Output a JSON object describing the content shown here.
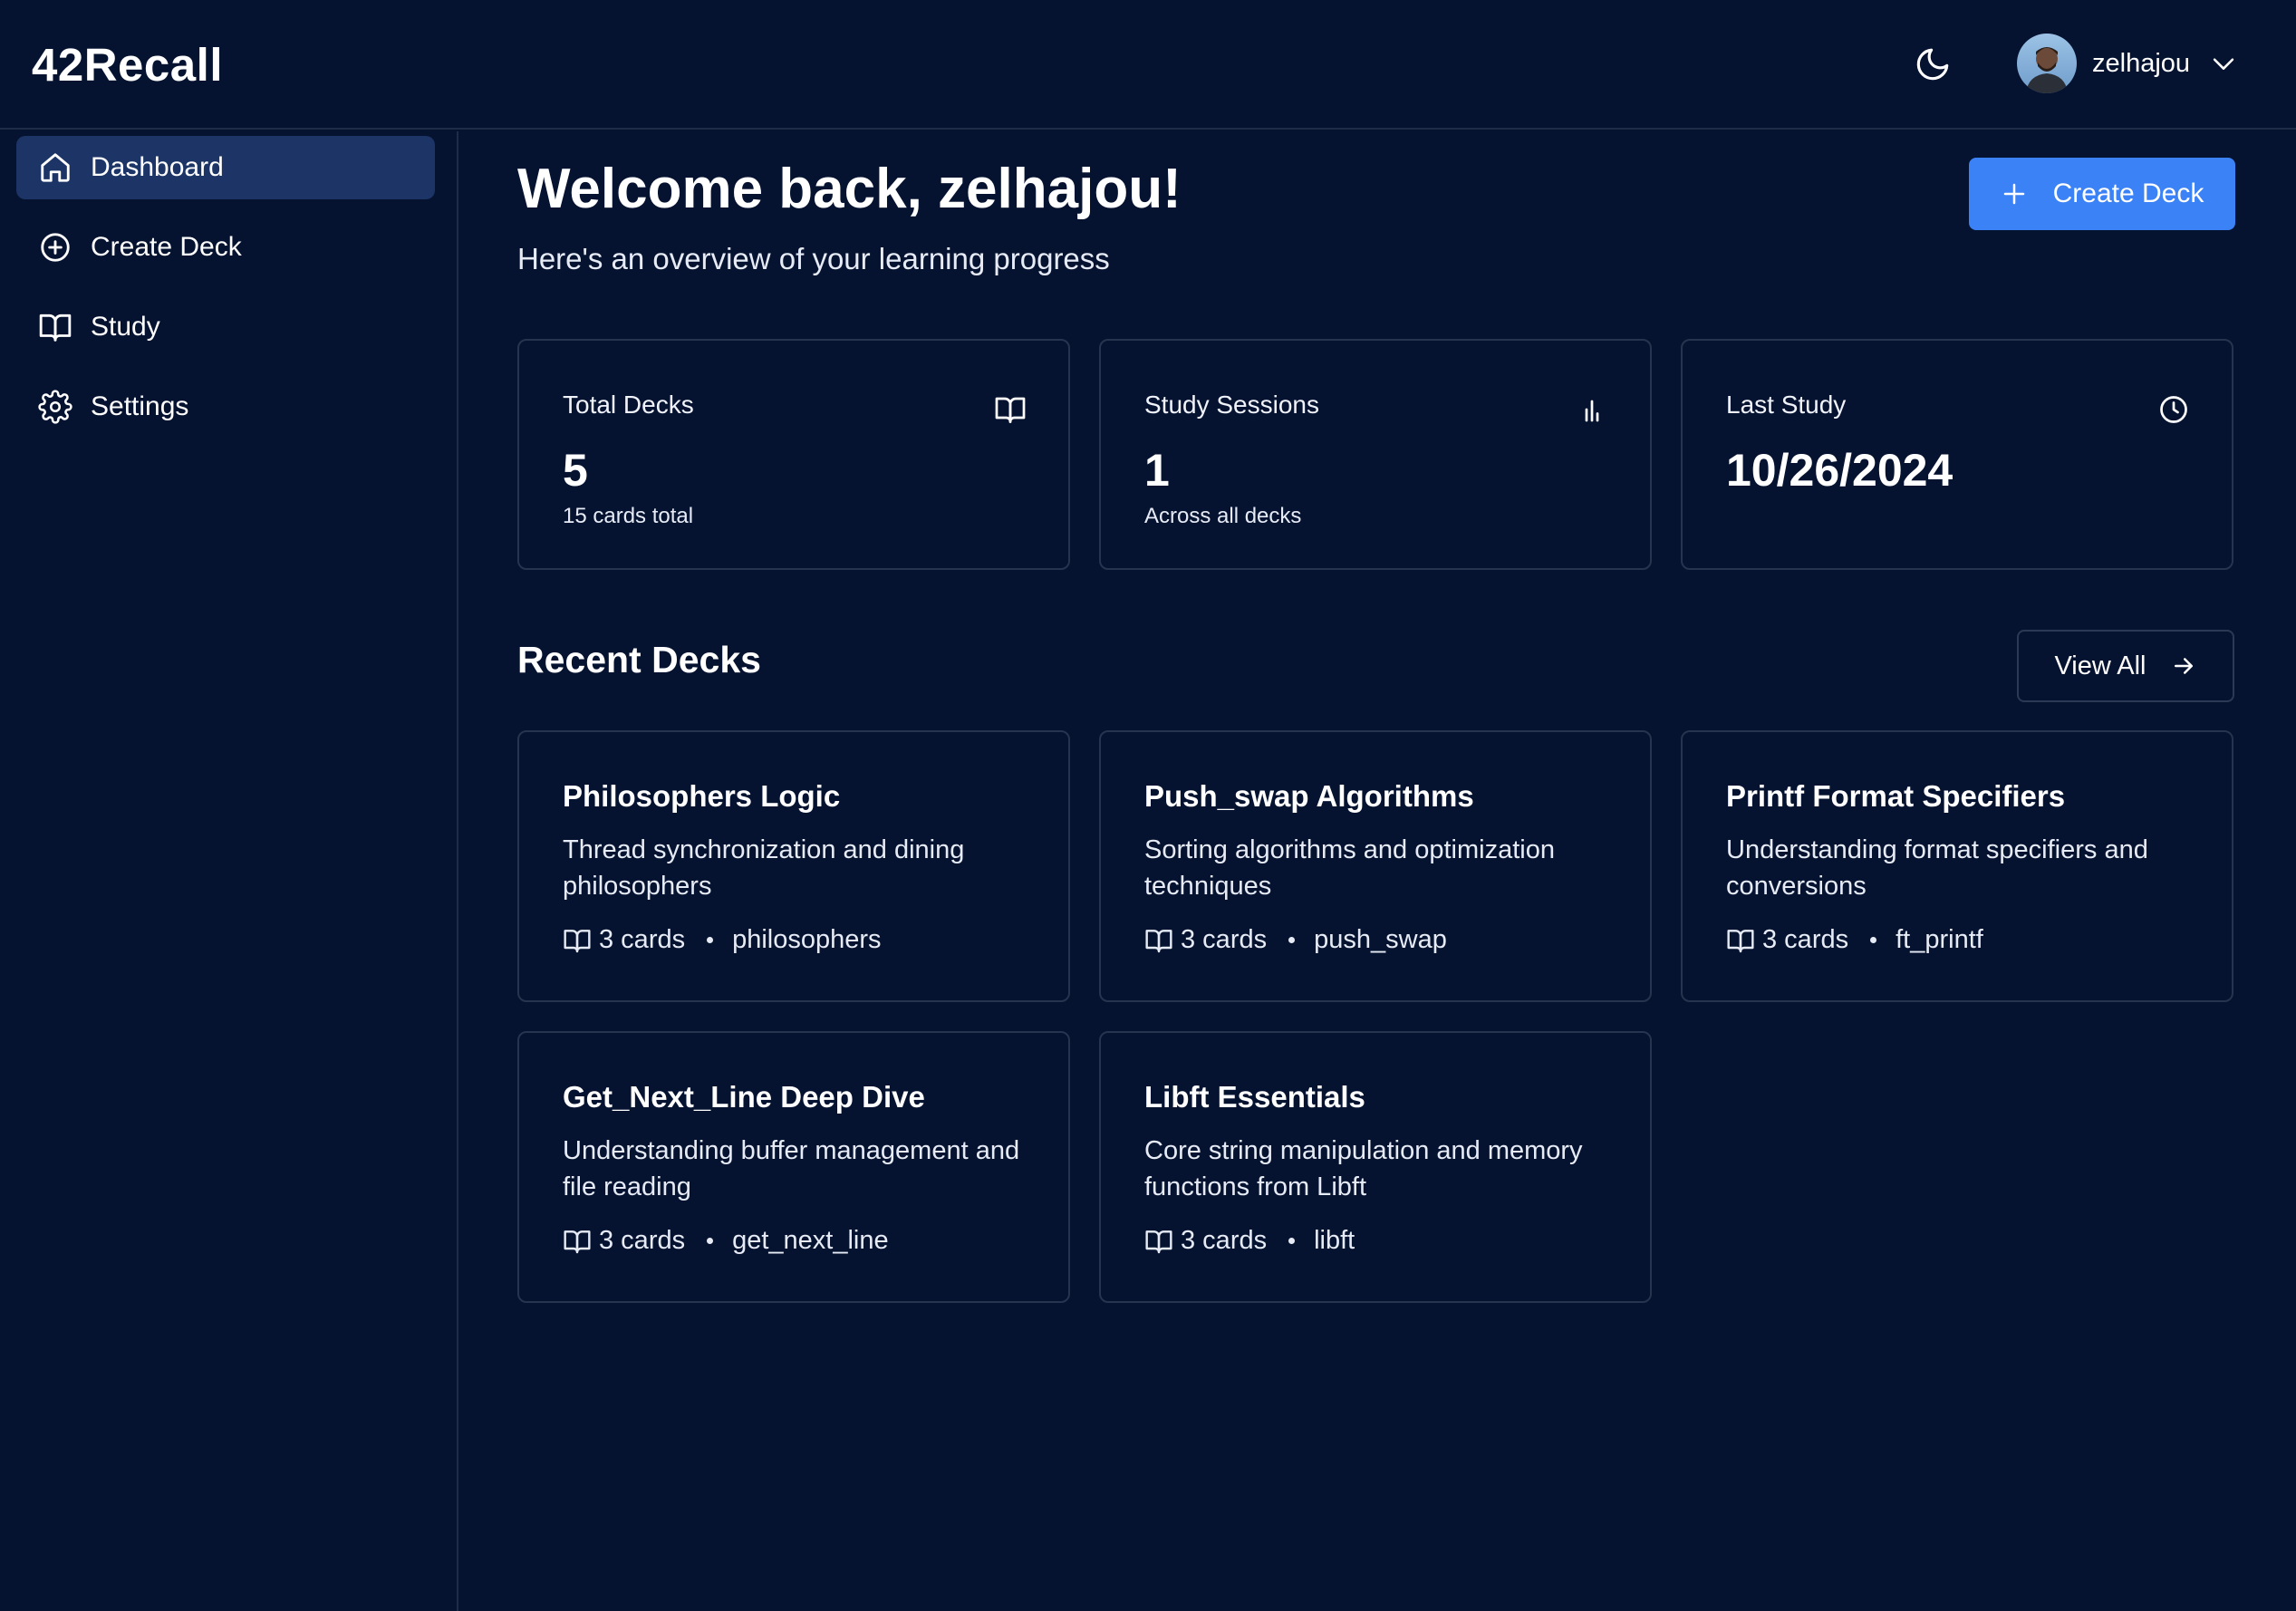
{
  "app": {
    "logo": "42Recall"
  },
  "header": {
    "user_name": "zelhajou"
  },
  "sidebar": {
    "items": [
      {
        "label": "Dashboard"
      },
      {
        "label": "Create Deck"
      },
      {
        "label": "Study"
      },
      {
        "label": "Settings"
      }
    ]
  },
  "main": {
    "welcome": "Welcome back, zelhajou!",
    "subtitle": "Here's an overview of your learning progress",
    "create_button": "Create Deck",
    "stats": [
      {
        "title": "Total Decks",
        "value": "5",
        "sub": "15 cards total",
        "icon": "book-open-icon"
      },
      {
        "title": "Study Sessions",
        "value": "1",
        "sub": "Across all decks",
        "icon": "bar-chart-icon"
      },
      {
        "title": "Last Study",
        "value": "10/26/2024",
        "sub": "",
        "icon": "clock-icon"
      }
    ],
    "recent_title": "Recent Decks",
    "view_all": "View All",
    "decks": [
      {
        "title": "Philosophers Logic",
        "desc": "Thread synchronization and dining philosophers",
        "cards": "3 cards",
        "tag": "philosophers"
      },
      {
        "title": "Push_swap Algorithms",
        "desc": "Sorting algorithms and optimization techniques",
        "cards": "3 cards",
        "tag": "push_swap"
      },
      {
        "title": "Printf Format Specifiers",
        "desc": "Understanding format specifiers and conversions",
        "cards": "3 cards",
        "tag": "ft_printf"
      },
      {
        "title": "Get_Next_Line Deep Dive",
        "desc": "Understanding buffer management and file reading",
        "cards": "3 cards",
        "tag": "get_next_line"
      },
      {
        "title": "Libft Essentials",
        "desc": "Core string manipulation and memory functions from Libft",
        "cards": "3 cards",
        "tag": "libft"
      }
    ]
  },
  "colors": {
    "background": "#061330",
    "accent": "#3b82f6",
    "active_nav": "#1c3466",
    "border": "#26344f"
  }
}
